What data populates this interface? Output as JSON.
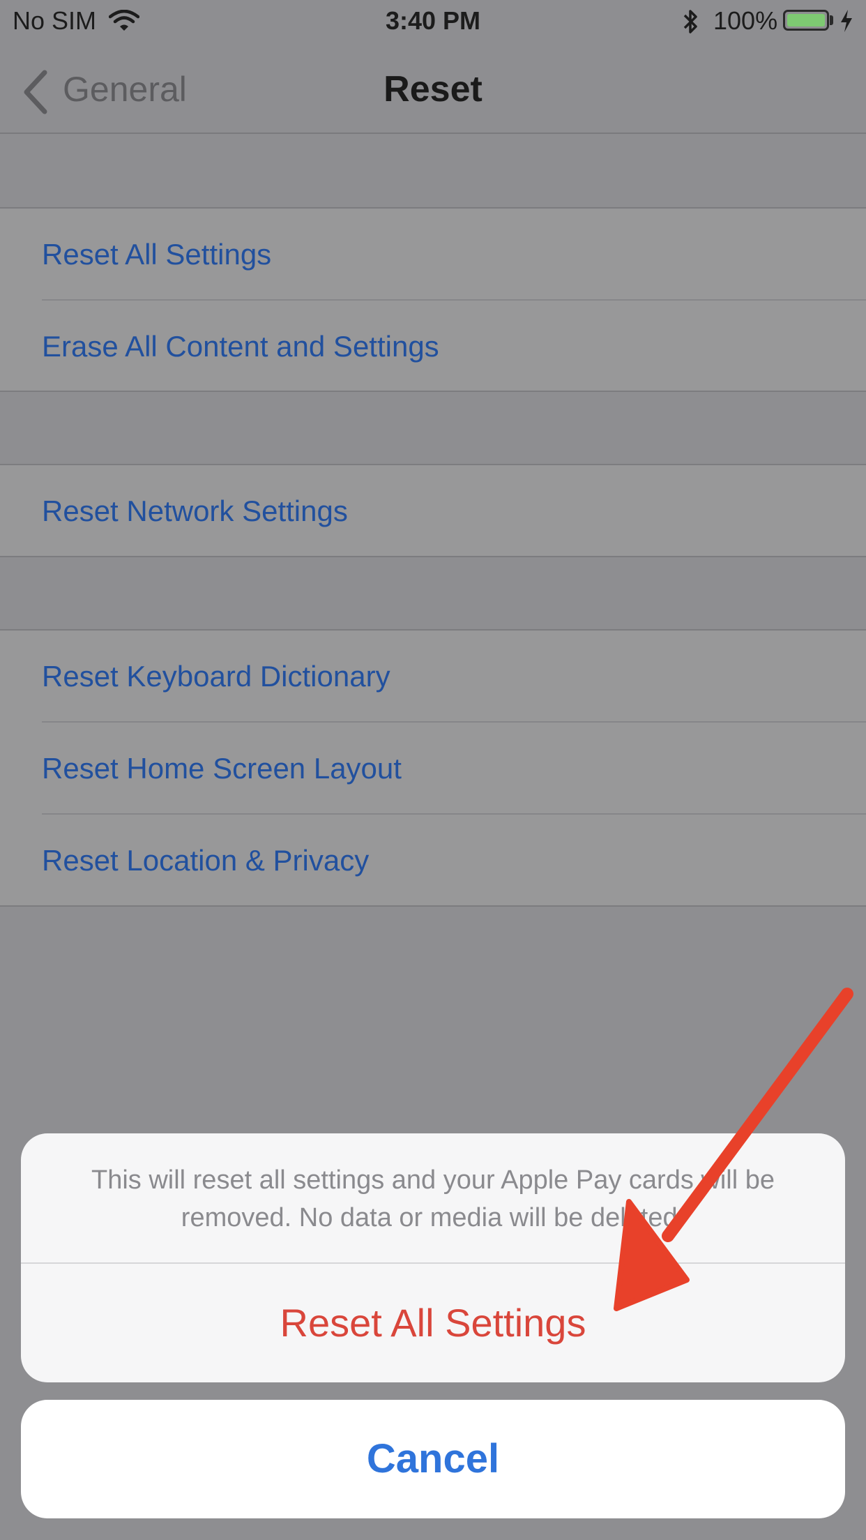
{
  "status_bar": {
    "carrier": "No SIM",
    "time": "3:40 PM",
    "battery_percent": "100%",
    "battery_level": 1.0
  },
  "nav": {
    "back_label": "General",
    "title": "Reset"
  },
  "groups": [
    {
      "items": [
        {
          "label": "Reset All Settings"
        },
        {
          "label": "Erase All Content and Settings"
        }
      ]
    },
    {
      "items": [
        {
          "label": "Reset Network Settings"
        }
      ]
    },
    {
      "items": [
        {
          "label": "Reset Keyboard Dictionary"
        },
        {
          "label": "Reset Home Screen Layout"
        },
        {
          "label": "Reset Location & Privacy"
        }
      ]
    }
  ],
  "action_sheet": {
    "message": "This will reset all settings and your Apple Pay cards will be removed. No data or media will be deleted.",
    "destructive_label": "Reset All Settings",
    "cancel_label": "Cancel"
  },
  "colors": {
    "link": "#21509e",
    "destructive": "#d9463b",
    "cancel": "#2f74db",
    "annotation_arrow": "#e8412a"
  },
  "annotation": {
    "icon": "red-arrow-icon"
  }
}
